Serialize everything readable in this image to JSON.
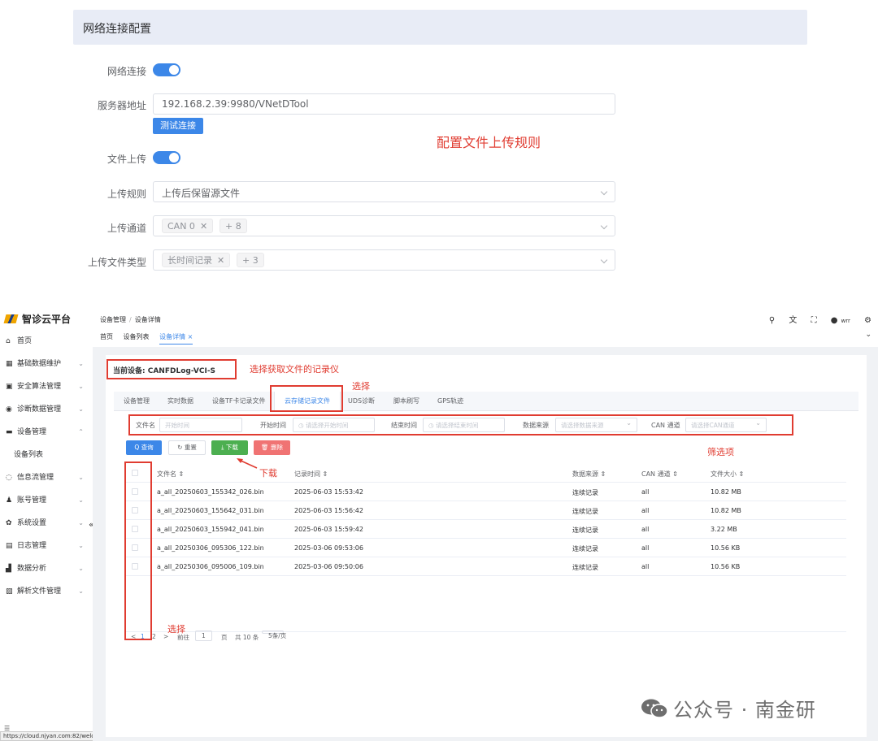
{
  "network_config": {
    "header": "网络连接配置",
    "network_label": "网络连接",
    "server_label": "服务器地址",
    "server_value": "192.168.2.39:9980/VNetDTool",
    "test_button": "测试连接",
    "upload_label": "文件上传",
    "rule_label": "上传规则",
    "rule_value": "上传后保留源文件",
    "channel_label": "上传通道",
    "channel_tag": "CAN 0",
    "channel_more": "+ 8",
    "filetype_label": "上传文件类型",
    "filetype_tag": "长时间记录",
    "filetype_more": "+ 3",
    "annotation": "配置文件上传规则"
  },
  "app": {
    "logo": "智诊云平台",
    "sidebar": {
      "home": "首页",
      "basic": "基础数据维护",
      "security": "安全算法管理",
      "diagnosis": "诊断数据管理",
      "device": "设备管理",
      "device_list": "设备列表",
      "infoflow": "信息流管理",
      "account": "账号管理",
      "system": "系统设置",
      "log": "日志管理",
      "analysis": "数据分析",
      "parse": "解析文件管理"
    },
    "breadcrumb": {
      "first": "设备管理",
      "sep": "/",
      "second": "设备详情"
    },
    "tagsbar": {
      "home": "首页",
      "list": "设备列表",
      "detail": "设备详情 ×"
    },
    "user": "wrr",
    "status_url": "https://cloud.njyan.com:82/welcome",
    "current_device": "当前设备:  CANFDLog-VCI-S",
    "annotations": {
      "device": "选择获取文件的记录仪",
      "tab_select": "选择",
      "filter": "筛选项",
      "download": "下载",
      "row_select": "选择"
    },
    "tabs": [
      "设备管理",
      "实时数据",
      "设备TF卡记录文件",
      "云存储记录文件",
      "UDS诊断",
      "脚本刷写",
      "GPS轨迹"
    ],
    "filters": {
      "filename_label": "文件名",
      "filename_ph": "开始时间",
      "start_label": "开始时间",
      "start_ph": "请选择开始时间",
      "end_label": "结束时间",
      "end_ph": "请选择结束时间",
      "source_label": "数据来源",
      "source_ph": "请选择数据来源",
      "can_label": "CAN 通道",
      "can_ph": "请选择CAN通道"
    },
    "buttons": {
      "query": "Q 查询",
      "reset": "↻ 重置",
      "download": "⤓ 下载",
      "delete": "🗑 删除"
    },
    "table": {
      "headers": [
        "文件名 ⇕",
        "记录时间 ⇕",
        "数据来源 ⇕",
        "CAN 通道 ⇕",
        "文件大小 ⇕"
      ],
      "rows": [
        [
          "a_all_20250603_155342_026.bin",
          "2025-06-03 15:53:42",
          "连续记录",
          "all",
          "10.82 MB"
        ],
        [
          "a_all_20250603_155642_031.bin",
          "2025-06-03 15:56:42",
          "连续记录",
          "all",
          "10.82 MB"
        ],
        [
          "a_all_20250603_155942_041.bin",
          "2025-06-03 15:59:42",
          "连续记录",
          "all",
          "3.22 MB"
        ],
        [
          "a_all_20250306_095306_122.bin",
          "2025-03-06 09:53:06",
          "连续记录",
          "all",
          "10.56 KB"
        ],
        [
          "a_all_20250306_095006_109.bin",
          "2025-03-06 09:50:06",
          "连续记录",
          "all",
          "10.56 KB"
        ]
      ]
    },
    "pagination": {
      "prev": "<",
      "p1": "1",
      "p2": "2",
      "next": ">",
      "goto": "前往",
      "page": "1",
      "page_unit": "页",
      "total": "共 10 条",
      "size": "5条/页"
    },
    "watermark": "公众号 · 南金研"
  },
  "colors": {
    "primary": "#3c87e8",
    "annotation_red": "#e03c31",
    "download_green": "#4caf50",
    "delete_red": "#f07373"
  }
}
